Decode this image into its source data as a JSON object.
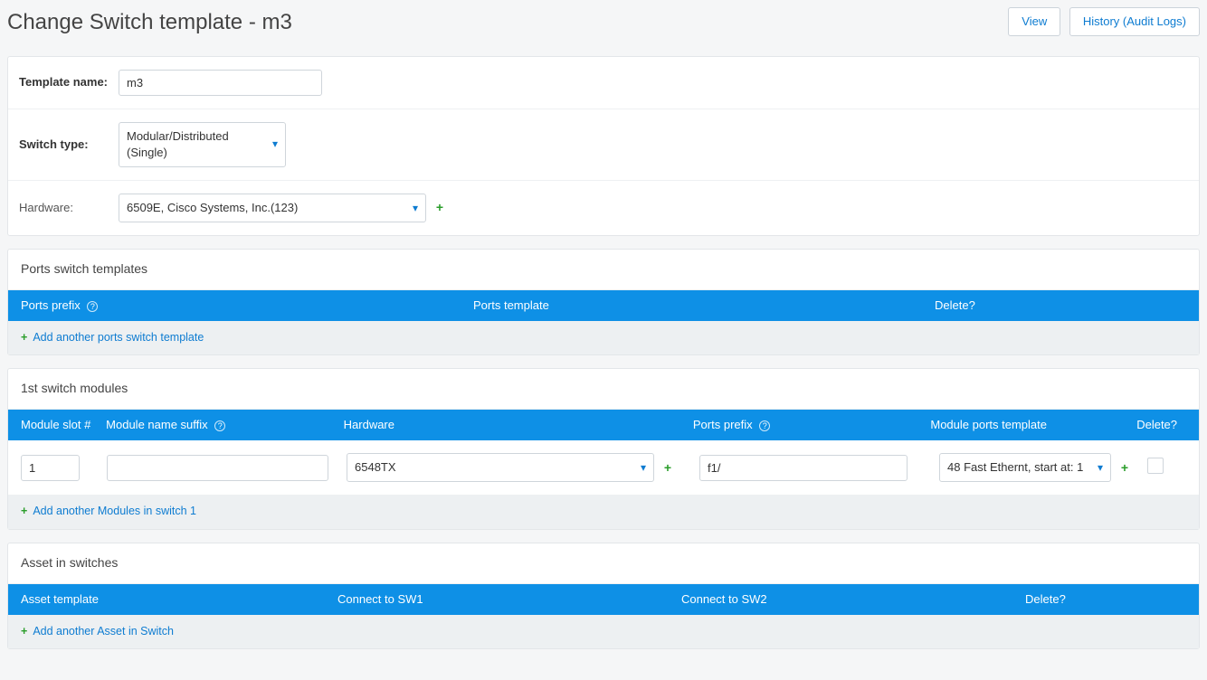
{
  "header": {
    "title": "Change Switch template - m3",
    "view_btn": "View",
    "history_btn": "History (Audit Logs)"
  },
  "form": {
    "template_name_label": "Template name:",
    "template_name_value": "m3",
    "switch_type_label": "Switch type:",
    "switch_type_value": "Modular/Distributed (Single)",
    "hardware_label": "Hardware:",
    "hardware_value": "6509E, Cisco Systems, Inc.(123)"
  },
  "ports_section": {
    "title": "Ports switch templates",
    "col_prefix": "Ports prefix",
    "col_template": "Ports template",
    "col_delete": "Delete?",
    "add_label": "Add another ports switch template"
  },
  "modules_section": {
    "title": "1st switch modules",
    "cols": {
      "slot": "Module slot #",
      "suffix": "Module name suffix",
      "hardware": "Hardware",
      "prefix": "Ports prefix",
      "template": "Module ports template",
      "delete": "Delete?"
    },
    "row": {
      "slot": "1",
      "suffix": "",
      "hardware": "6548TX",
      "prefix": "f1/",
      "template": "48 Fast Ethernt, start at: 1"
    },
    "add_label": "Add another Modules in switch 1"
  },
  "asset_section": {
    "title": "Asset in switches",
    "cols": {
      "template": "Asset template",
      "sw1": "Connect to SW1",
      "sw2": "Connect to SW2",
      "delete": "Delete?"
    },
    "add_label": "Add another Asset in Switch"
  }
}
